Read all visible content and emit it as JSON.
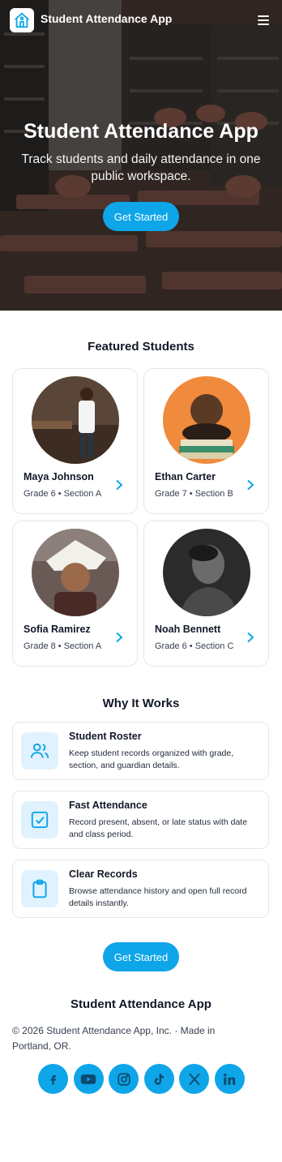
{
  "header": {
    "brand": "Student Attendance App",
    "logo_icon": "school-building-icon",
    "menu_icon": "hamburger-menu-icon"
  },
  "hero": {
    "title": "Student Attendance App",
    "subtitle": "Track students and daily attendance in one public workspace.",
    "cta_label": "Get Started"
  },
  "featured": {
    "title": "Featured Students",
    "students": [
      {
        "name": "Maya Johnson",
        "meta": "Grade 6 • Section A"
      },
      {
        "name": "Ethan Carter",
        "meta": "Grade 7 • Section B"
      },
      {
        "name": "Sofia Ramirez",
        "meta": "Grade 8 • Section A"
      },
      {
        "name": "Noah Bennett",
        "meta": "Grade 6 • Section C"
      }
    ]
  },
  "why": {
    "title": "Why It Works",
    "features": [
      {
        "icon": "users-icon",
        "title": "Student Roster",
        "desc": "Keep student records organized with grade, section, and guardian details."
      },
      {
        "icon": "checkbox-icon",
        "title": "Fast Attendance",
        "desc": "Record present, absent, or late status with date and class period."
      },
      {
        "icon": "clipboard-icon",
        "title": "Clear Records",
        "desc": "Browse attendance history and open full record details instantly."
      }
    ]
  },
  "cta": {
    "label": "Get Started"
  },
  "footer": {
    "brand": "Student Attendance App",
    "copyright": "© 2026 Student Attendance App, Inc. · Made in Portland, OR.",
    "socials": [
      "facebook-icon",
      "youtube-icon",
      "instagram-icon",
      "tiktok-icon",
      "x-icon",
      "linkedin-icon"
    ]
  },
  "colors": {
    "accent": "#0ea5e9",
    "accent_soft": "#e0f2fe",
    "text": "#111827"
  }
}
